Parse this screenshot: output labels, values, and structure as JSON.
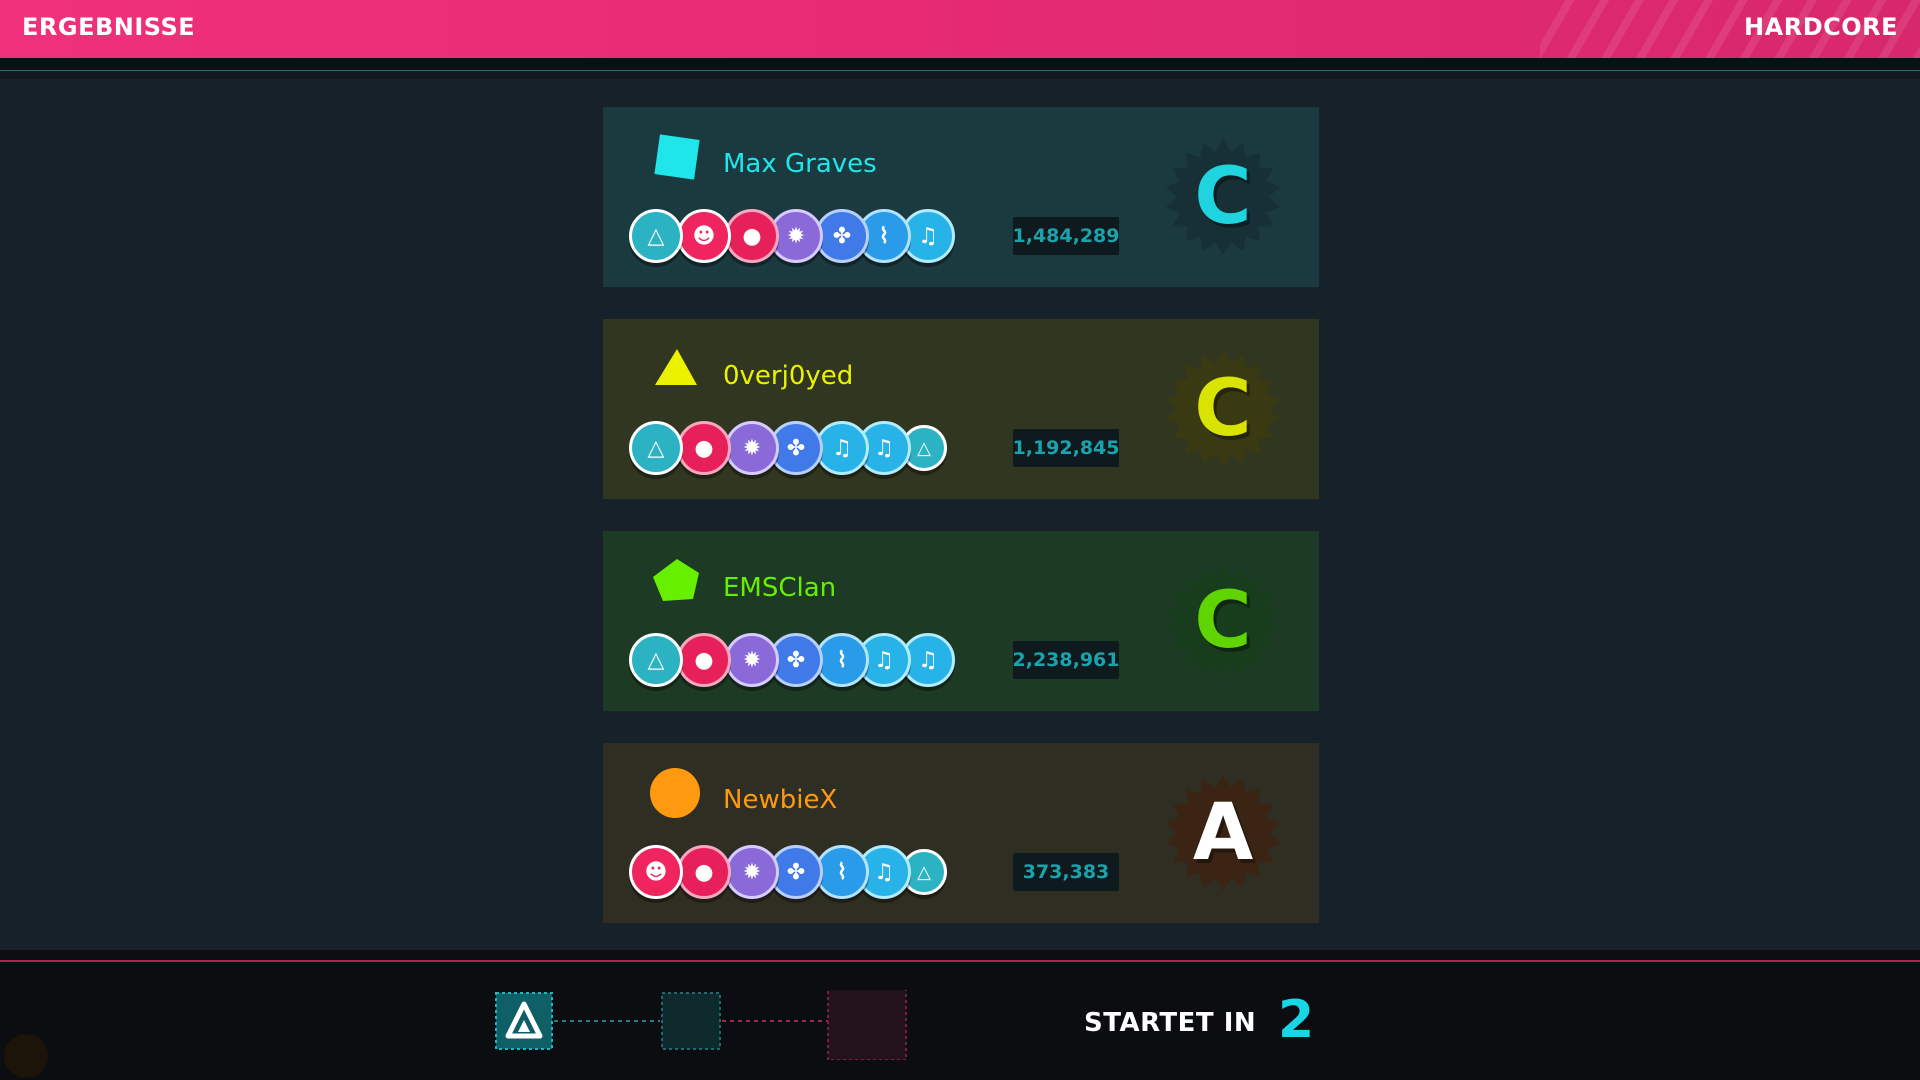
{
  "header": {
    "title": "ERGEBNISSE",
    "mode": "HARDCORE"
  },
  "players": [
    {
      "name": "Max Graves",
      "shape": "square",
      "color": "#1ee6ea",
      "card_bg": "#1b3a3f",
      "score": "1,484,289",
      "rank": "C",
      "rank_color": "#1fd3df",
      "rank_burst": "#163036",
      "tokens": [
        "triangle-icon",
        "skull-icon",
        "bomb-icon",
        "virus-icon",
        "molecule-icon",
        "pill-icon",
        "note-icon"
      ]
    },
    {
      "name": "0verj0yed",
      "shape": "triangle",
      "color": "#eaf200",
      "card_bg": "#30361f",
      "score": "1,192,845",
      "rank": "C",
      "rank_color": "#d9e300",
      "rank_burst": "#3a3a12",
      "tokens": [
        "triangle-icon",
        "bomb-icon",
        "virus-icon",
        "molecule-icon",
        "note-icon",
        "note-icon",
        "triangle-icon"
      ]
    },
    {
      "name": "EMSClan",
      "shape": "pentagon",
      "color": "#66f000",
      "card_bg": "#1d3a25",
      "score": "2,238,961",
      "rank": "C",
      "rank_color": "#5fd400",
      "rank_burst": "#173d1c",
      "tokens": [
        "triangle-icon",
        "bomb-icon",
        "virus-icon",
        "molecule-icon",
        "pill-icon",
        "note-icon",
        "note-icon"
      ]
    },
    {
      "name": "NewbieX",
      "shape": "circle",
      "color": "#ff9a10",
      "card_bg": "#2f2e22",
      "score": "373,383",
      "rank": "A",
      "rank_color": "#ffffff",
      "rank_burst": "#3b2413",
      "tokens": [
        "skull-icon",
        "bomb-icon",
        "virus-icon",
        "molecule-icon",
        "pill-icon",
        "note-icon",
        "triangle-icon"
      ]
    }
  ],
  "footer": {
    "starts_label": "STARTET IN",
    "countdown": "2"
  }
}
